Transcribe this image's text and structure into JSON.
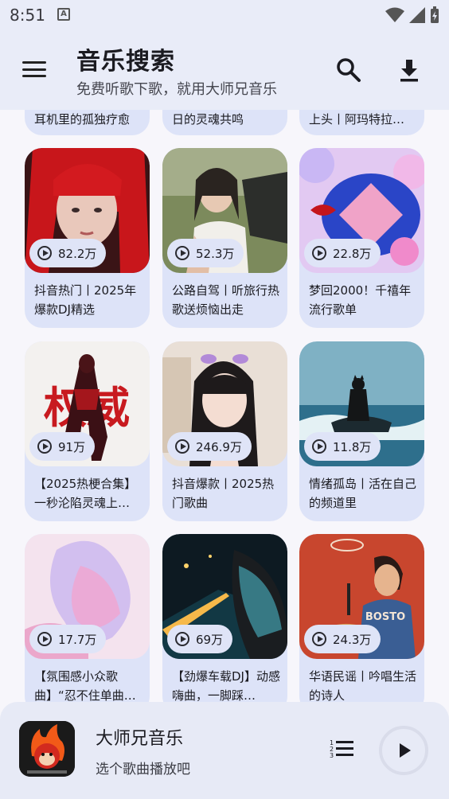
{
  "status_bar": {
    "time": "8:51",
    "notification_icon": "A"
  },
  "app_bar": {
    "title": "音乐搜索",
    "subtitle": "免费听歌下歌，就用大师兄音乐",
    "icons": [
      "menu-icon",
      "search-icon",
      "download-icon"
    ]
  },
  "top_row": [
    {
      "text": "耳机里的孤独疗愈"
    },
    {
      "text": "日的灵魂共鸣"
    },
    {
      "text": "上头丨阿玛特拉…"
    }
  ],
  "cards": [
    {
      "plays": "82.2万",
      "text": "抖音热门丨2025年爆款DJ精选"
    },
    {
      "plays": "52.3万",
      "text": "公路自驾丨听旅行热歌送烦恼出走"
    },
    {
      "plays": "22.8万",
      "text": "梦回2000！千禧年流行歌单"
    },
    {
      "plays": "91万",
      "text": "【2025热梗合集】一秒沦陷灵魂上…",
      "cover_text": "权威"
    },
    {
      "plays": "246.9万",
      "text": "抖音爆款丨2025热门歌曲"
    },
    {
      "plays": "11.8万",
      "text": "情绪孤岛丨活在自己的频道里"
    },
    {
      "plays": "17.7万",
      "text": "【氛围感小众歌曲】“忍不住单曲…"
    },
    {
      "plays": "69万",
      "text": "【劲爆车载DJ】动感嗨曲，一脚踩…"
    },
    {
      "plays": "24.3万",
      "text": "华语民谣丨吟唱生活的诗人",
      "cover_text": "BOSTO"
    }
  ],
  "player": {
    "title": "大师兄音乐",
    "subtitle": "选个歌曲播放吧",
    "icons": [
      "queue-icon",
      "play-icon"
    ]
  },
  "colors": {
    "app_bar": "#e9ecf8",
    "card": "#dde3f8",
    "background": "#f7f6fb"
  }
}
